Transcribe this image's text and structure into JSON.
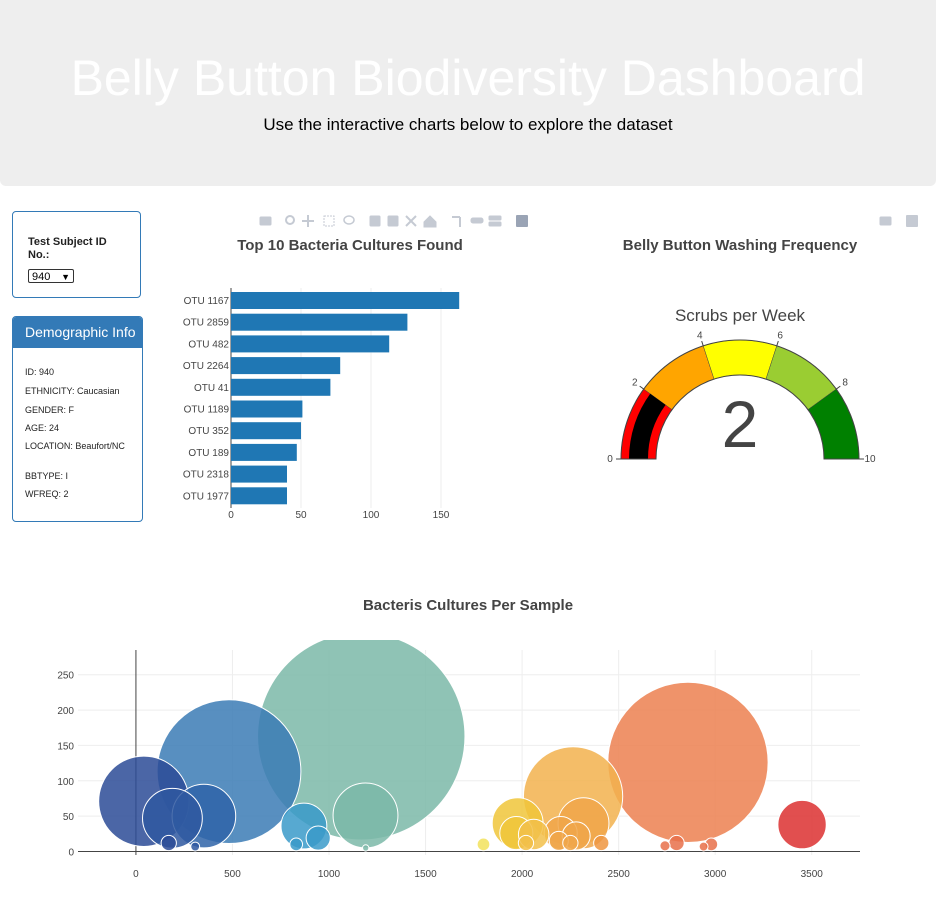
{
  "header": {
    "title": "Belly Button Biodiversity Dashboard",
    "subtitle": "Use the interactive charts below to explore the dataset"
  },
  "selector": {
    "label": "Test Subject ID No.:",
    "selected": "940"
  },
  "demographics": {
    "heading": "Demographic Info",
    "items": [
      "ID: 940",
      "ETHNICITY: Caucasian",
      "GENDER: F",
      "AGE: 24",
      "LOCATION: Beaufort/NC",
      "BBTYPE: I",
      "WFREQ: 2"
    ]
  },
  "toolbar_icons": [
    "camera-icon",
    "zoom-icon",
    "pan-icon",
    "box-select-icon",
    "lasso-icon",
    "zoom-in-icon",
    "zoom-out-icon",
    "autoscale-icon",
    "reset-axes-icon",
    "spike-lines-icon",
    "hover-closest-icon",
    "hover-compare-icon",
    "plotly-logo-icon"
  ],
  "colors": {
    "bar": "#1f77b4",
    "panel_border": "#337ab7",
    "gauge_red": "#ff0000",
    "gauge_orange": "#ffa500",
    "gauge_yellow": "#ffff00",
    "gauge_yellowgreen": "#9acd32",
    "gauge_green": "#008000",
    "gauge_needle": "#000000"
  },
  "chart_data": [
    {
      "type": "bar",
      "orientation": "horizontal",
      "title": "Top 10 Bacteria Cultures Found",
      "categories": [
        "OTU 1167",
        "OTU 2859",
        "OTU 482",
        "OTU 2264",
        "OTU 41",
        "OTU 1189",
        "OTU 352",
        "OTU 189",
        "OTU 2318",
        "OTU 1977"
      ],
      "values": [
        163,
        126,
        113,
        78,
        71,
        51,
        50,
        47,
        40,
        40
      ],
      "xlim": [
        0,
        170
      ],
      "xticks": [
        0,
        50,
        100,
        150
      ]
    },
    {
      "type": "gauge",
      "title": "Belly Button Washing Frequency",
      "subtitle": "Scrubs per Week",
      "value": 2,
      "range": [
        0,
        10
      ],
      "ticks": [
        0,
        2,
        4,
        6,
        8,
        10
      ],
      "steps": [
        {
          "range": [
            0,
            2
          ],
          "color": "#ff0000"
        },
        {
          "range": [
            2,
            4
          ],
          "color": "#ffa500"
        },
        {
          "range": [
            4,
            6
          ],
          "color": "#ffff00"
        },
        {
          "range": [
            6,
            8
          ],
          "color": "#9acd32"
        },
        {
          "range": [
            8,
            10
          ],
          "color": "#008000"
        }
      ]
    },
    {
      "type": "scatter",
      "subtype": "bubble",
      "title": "Bacteris Cultures Per Sample",
      "xlim": [
        -300,
        3750
      ],
      "ylim": [
        -5,
        285
      ],
      "xticks": [
        0,
        500,
        1000,
        1500,
        2000,
        2500,
        3000,
        3500
      ],
      "yticks": [
        0,
        50,
        100,
        150,
        200,
        250
      ],
      "points": [
        {
          "x": 41,
          "y": 71,
          "size": 71,
          "color": "#2c4b96"
        },
        {
          "x": 189,
          "y": 47,
          "size": 47,
          "color": "#2f58a0"
        },
        {
          "x": 352,
          "y": 50,
          "size": 50,
          "color": "#2f64a8"
        },
        {
          "x": 482,
          "y": 113,
          "size": 113,
          "color": "#3b7bb5"
        },
        {
          "x": 170,
          "y": 12,
          "size": 12,
          "color": "#2c4b96"
        },
        {
          "x": 307,
          "y": 7,
          "size": 7,
          "color": "#2f58a0"
        },
        {
          "x": 870,
          "y": 36,
          "size": 36,
          "color": "#3a9ac9"
        },
        {
          "x": 944,
          "y": 19,
          "size": 19,
          "color": "#3a9ac9"
        },
        {
          "x": 830,
          "y": 10,
          "size": 10,
          "color": "#3a9ac9"
        },
        {
          "x": 1167,
          "y": 163,
          "size": 163,
          "color": "#7bb8a8"
        },
        {
          "x": 1189,
          "y": 51,
          "size": 51,
          "color": "#7bb8a8"
        },
        {
          "x": 1190,
          "y": 5,
          "size": 5,
          "color": "#7bb8a8"
        },
        {
          "x": 1800,
          "y": 10,
          "size": 10,
          "color": "#f2e25c"
        },
        {
          "x": 1977,
          "y": 40,
          "size": 40,
          "color": "#f0c63a"
        },
        {
          "x": 1970,
          "y": 26,
          "size": 26,
          "color": "#f0c63a"
        },
        {
          "x": 2060,
          "y": 24,
          "size": 24,
          "color": "#f2c04a"
        },
        {
          "x": 2020,
          "y": 12,
          "size": 12,
          "color": "#f2c04a"
        },
        {
          "x": 2264,
          "y": 78,
          "size": 78,
          "color": "#f2b24e"
        },
        {
          "x": 2318,
          "y": 40,
          "size": 40,
          "color": "#f0a64a"
        },
        {
          "x": 2200,
          "y": 26,
          "size": 26,
          "color": "#f0a64a"
        },
        {
          "x": 2280,
          "y": 22,
          "size": 22,
          "color": "#f0a64a"
        },
        {
          "x": 2190,
          "y": 15,
          "size": 15,
          "color": "#f0a64a"
        },
        {
          "x": 2250,
          "y": 12,
          "size": 12,
          "color": "#f0a64a"
        },
        {
          "x": 2410,
          "y": 12,
          "size": 12,
          "color": "#ef9540"
        },
        {
          "x": 2859,
          "y": 126,
          "size": 126,
          "color": "#ec8050"
        },
        {
          "x": 2740,
          "y": 8,
          "size": 8,
          "color": "#e8704a"
        },
        {
          "x": 2800,
          "y": 12,
          "size": 12,
          "color": "#e8704a"
        },
        {
          "x": 2980,
          "y": 10,
          "size": 10,
          "color": "#e8704a"
        },
        {
          "x": 2940,
          "y": 7,
          "size": 7,
          "color": "#e8704a"
        },
        {
          "x": 3450,
          "y": 38,
          "size": 38,
          "color": "#dc3030"
        }
      ]
    }
  ]
}
